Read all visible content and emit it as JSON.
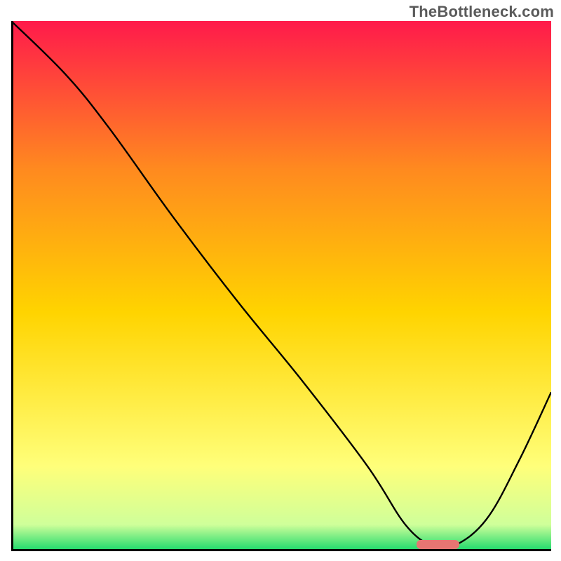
{
  "watermark": "TheBottleneck.com",
  "chart_data": {
    "type": "line",
    "title": "",
    "xlabel": "",
    "ylabel": "",
    "xlim": [
      0,
      100
    ],
    "ylim": [
      0,
      100
    ],
    "grid": false,
    "legend": false,
    "background_gradient": {
      "top": "#ff1a4b",
      "mid_upper": "#ff8a1f",
      "mid": "#ffd400",
      "mid_lower": "#ffff7a",
      "near_bottom": "#cfff9a",
      "bottom": "#18d86b"
    },
    "series": [
      {
        "name": "bottleneck-curve",
        "x": [
          0,
          10,
          18,
          30,
          42,
          54,
          66,
          73,
          78,
          82,
          88,
          94,
          100
        ],
        "y": [
          100,
          90,
          80,
          63,
          47,
          32,
          16,
          5,
          1,
          1,
          6,
          17,
          30
        ]
      }
    ],
    "marker": {
      "name": "optimal-range",
      "x_start": 75,
      "x_end": 83,
      "y": 1.3,
      "color": "#e77572"
    }
  },
  "colors": {
    "axis": "#000000",
    "curve": "#000000",
    "marker": "#e77572",
    "watermark": "#5a5a5a"
  }
}
